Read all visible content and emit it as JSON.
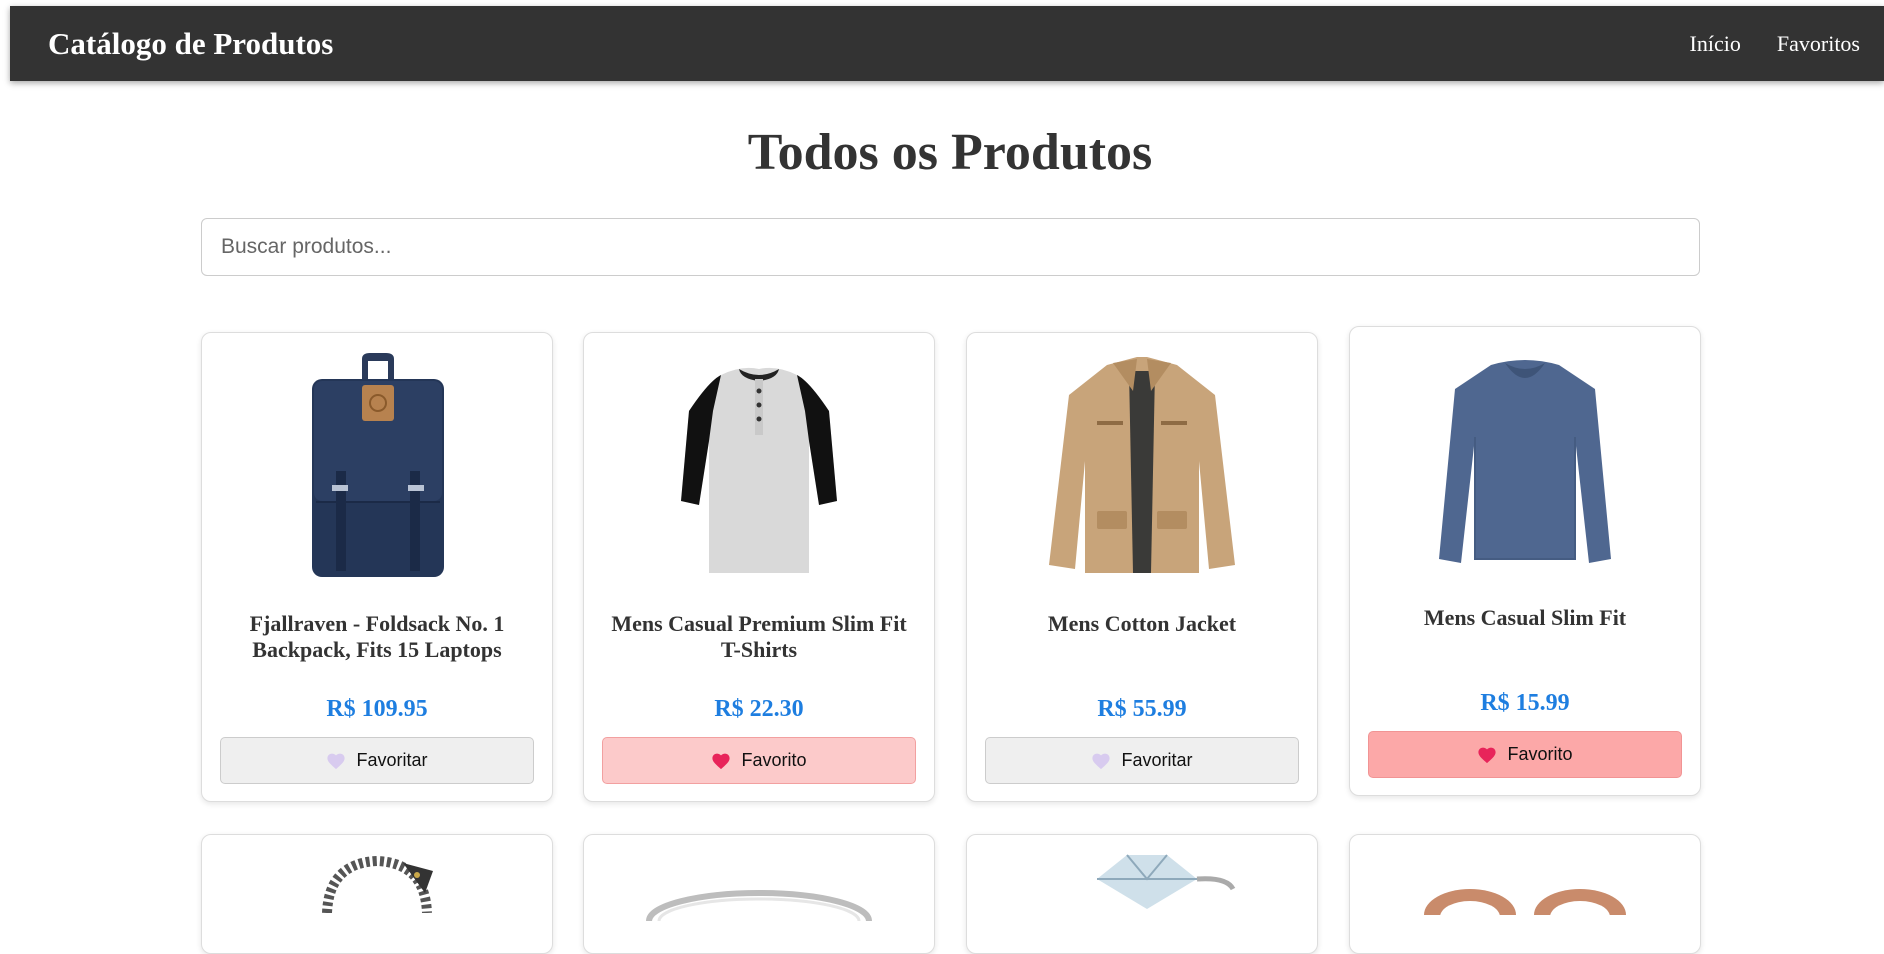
{
  "header": {
    "brand": "Catálogo de Produtos",
    "nav": [
      "Início",
      "Favoritos"
    ]
  },
  "page": {
    "title": "Todos os Produtos"
  },
  "search": {
    "placeholder": "Buscar produtos...",
    "value": ""
  },
  "products": [
    {
      "title": "Fjallraven - Foldsack No. 1 Backpack, Fits 15 Laptops",
      "price": "R$ 109.95",
      "button": "Favoritar",
      "favorited": false,
      "image": "backpack-image"
    },
    {
      "title": "Mens Casual Premium Slim Fit T-Shirts",
      "price": "R$ 22.30",
      "button": "Favorito",
      "favorited": true,
      "image": "raglan-tshirt-image"
    },
    {
      "title": "Mens Cotton Jacket",
      "price": "R$ 55.99",
      "button": "Favoritar",
      "favorited": false,
      "image": "cotton-jacket-image"
    },
    {
      "title": "Mens Casual Slim Fit",
      "price": "R$ 15.99",
      "button": "Favorito",
      "favorited": true,
      "image": "longsleeve-shirt-image"
    }
  ],
  "partial_row_images": [
    "bracelet-image",
    "ring-image",
    "diamond-ring-image",
    "earrings-image"
  ],
  "colors": {
    "header_bg": "#333333",
    "price": "#1e7ee0",
    "favorite_bg": "#fccaca",
    "favorite_hover_bg": "#fca8a8",
    "heart_active": "#e8245a",
    "heart_inactive": "#d8cbef"
  }
}
